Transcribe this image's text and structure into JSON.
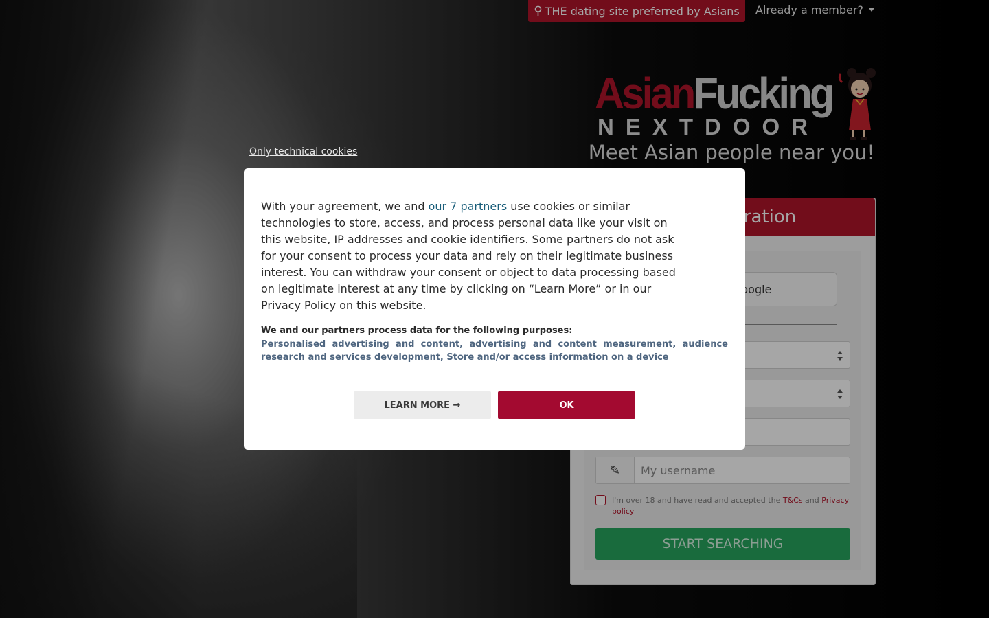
{
  "topbar": {
    "tagline_icon": "female-symbol-icon",
    "tagline": "THE dating site preferred by Asians",
    "member_label": "Already a member?"
  },
  "logo": {
    "line1_part1": "Asian",
    "line1_part2": "Fucking",
    "line2": "NEXTDOOR",
    "subtitle": "Meet Asian people near you!"
  },
  "registration": {
    "header": "Free registration",
    "google_label": "Sign up with Google",
    "username_placeholder": "My username",
    "terms_prefix": "I'm over 18 and have read and accepted the ",
    "terms_link": "T&Cs",
    "terms_and": " and ",
    "privacy_link": "Privacy policy",
    "submit_label": "START SEARCHING"
  },
  "cookie": {
    "only_technical": "Only technical cookies",
    "text_before": "With your agreement, we and ",
    "partners_link": "our 7 partners",
    "text_after": " use cookies or similar technologies to store, access, and process personal data like your visit on this website, IP addresses and cookie identifiers. Some partners do not ask for your consent to process your data and rely on their legitimate business interest. You can withdraw your consent or object to data processing based on legitimate interest at any time by clicking on “Learn More” or in our Privacy Policy on this website.",
    "purposes_title": "We and our partners process data for the following purposes:",
    "purposes_list": "Personalised advertising and content, advertising and content measurement, audience research and services development, Store and/or access information on a device",
    "learn_more": "LEARN MORE →",
    "ok": "OK"
  },
  "colors": {
    "brand_red": "#b0152a",
    "ok_red": "#a30a30",
    "green": "#27a55f"
  }
}
